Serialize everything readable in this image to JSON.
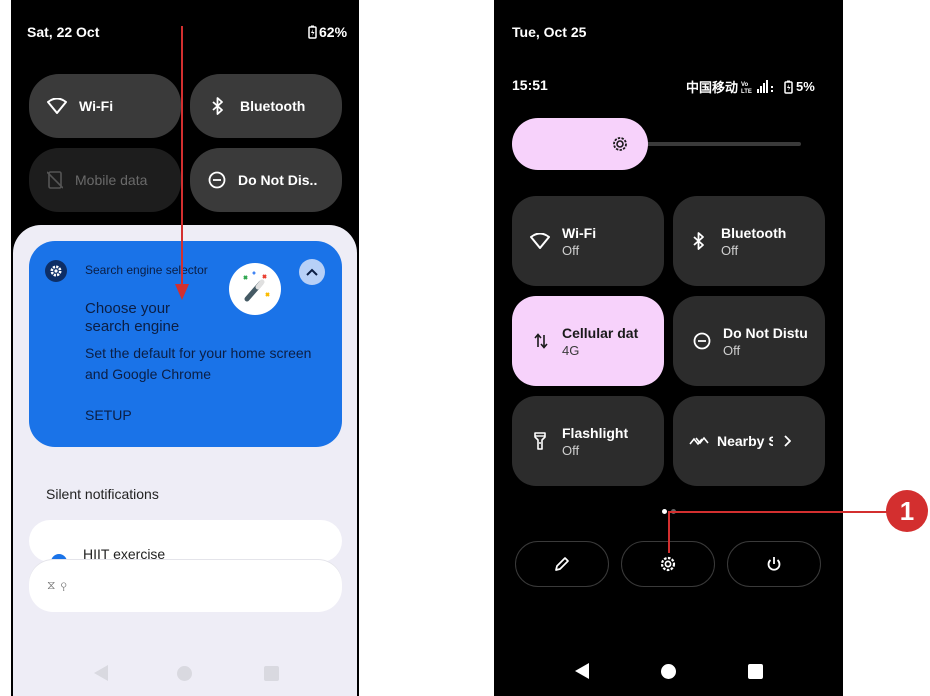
{
  "left_phone": {
    "status_date": "Sat, 22 Oct",
    "battery": "62%",
    "tiles": [
      {
        "label": "Wi-Fi",
        "icon": "wifi-icon"
      },
      {
        "label": "Bluetooth",
        "icon": "bluetooth-icon"
      },
      {
        "label": "Mobile data",
        "icon": "mobile-data-off-icon"
      },
      {
        "label": "Do Not Dis..",
        "icon": "do-not-disturb-icon"
      }
    ],
    "notification": {
      "app": "Search engine selector",
      "title": "Choose your search engine",
      "body": "Set the default for your home screen and Google Chrome",
      "action": "SETUP",
      "icon": "magic-wand-icon"
    },
    "silent_header": "Silent notifications",
    "silent_item": "HIIT exercise",
    "system_icons": "⧖ ⚲"
  },
  "right_phone": {
    "status_date": "Tue, Oct 25",
    "time": "15:51",
    "carrier": "中国移动",
    "battery": "5%",
    "tiles": [
      {
        "title": "Wi-Fi",
        "subtitle": "Off",
        "icon": "wifi-icon",
        "active": false
      },
      {
        "title": "Bluetooth",
        "subtitle": "Off",
        "icon": "bluetooth-icon",
        "active": false
      },
      {
        "title": "Cellular dat",
        "subtitle": "4G",
        "icon": "cellular-data-icon",
        "active": true
      },
      {
        "title": "Do Not Distu",
        "subtitle": "Off",
        "icon": "do-not-disturb-icon",
        "active": false
      },
      {
        "title": "Flashlight",
        "subtitle": "Off",
        "icon": "flashlight-icon",
        "active": false
      },
      {
        "title": "Nearby S",
        "subtitle": "",
        "icon": "nearby-share-icon",
        "active": false
      }
    ],
    "bottom_buttons": [
      "edit-icon",
      "settings-icon",
      "power-icon"
    ]
  },
  "callout": {
    "number": "1"
  },
  "colors": {
    "tile_dark": "#2c2c2c",
    "tile_active": "#f7d2fb",
    "notification_blue": "#1a73e8",
    "callout_red": "#d32f2f"
  }
}
